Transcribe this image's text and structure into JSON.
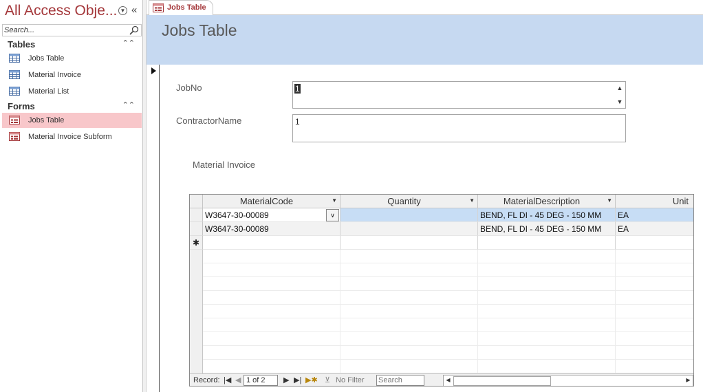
{
  "nav": {
    "title": "All Access Obje...",
    "search_placeholder": "Search...",
    "groups": [
      {
        "label": "Tables",
        "items": [
          {
            "label": "Jobs Table"
          },
          {
            "label": "Material Invoice"
          },
          {
            "label": "Material List"
          }
        ]
      },
      {
        "label": "Forms",
        "items": [
          {
            "label": "Jobs Table",
            "selected": true
          },
          {
            "label": "Material Invoice Subform"
          }
        ]
      }
    ]
  },
  "document_tab": {
    "label": "Jobs Table"
  },
  "form": {
    "title": "Jobs Table",
    "fields": [
      {
        "label": "JobNo",
        "value": "1"
      },
      {
        "label": "ContractorName",
        "value": "1"
      }
    ],
    "subform_label": "Material Invoice"
  },
  "subform": {
    "columns": [
      "MaterialCode",
      "Quantity",
      "MaterialDescription",
      "Unit"
    ],
    "rows": [
      {
        "MaterialCode": "W3647-30-00089",
        "Quantity": "",
        "MaterialDescription": "BEND, FL DI - 45 DEG - 150 MM",
        "Unit": "EA"
      },
      {
        "MaterialCode": "W3647-30-00089",
        "Quantity": "",
        "MaterialDescription": "BEND, FL DI - 45 DEG - 150 MM",
        "Unit": "EA"
      }
    ],
    "new_row_marker": "✱",
    "navbar": {
      "record_label": "Record:",
      "position": "1 of 2",
      "filter_label": "No Filter",
      "search_placeholder": "Search"
    }
  },
  "colors": {
    "accent": "#a4373a",
    "header_band": "#c6d9f1",
    "selected_nav": "#f8c7ca"
  }
}
